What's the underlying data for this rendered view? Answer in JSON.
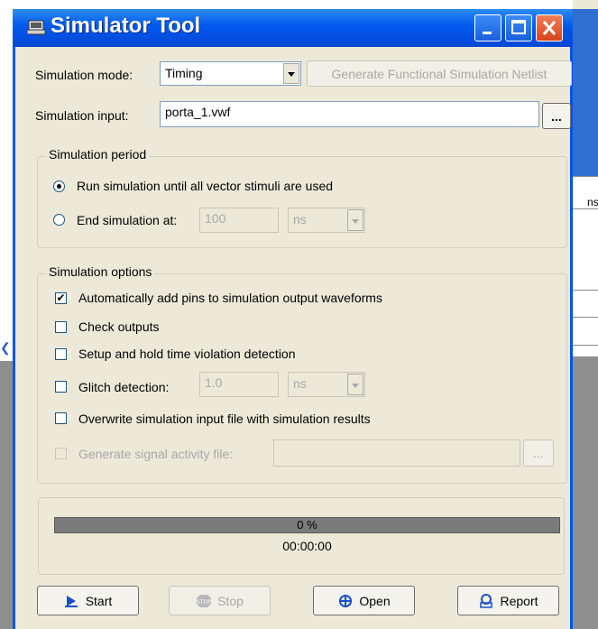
{
  "window": {
    "title": "Simulator Tool"
  },
  "mode": {
    "label": "Simulation mode:",
    "value": "Timing",
    "netlist_button": "Generate Functional Simulation Netlist"
  },
  "input": {
    "label": "Simulation input:",
    "value": "porta_1.vwf",
    "browse": "..."
  },
  "period": {
    "title": "Simulation period",
    "run_all": "Run simulation until all vector stimuli are used",
    "end_at": "End simulation at:",
    "end_value": "100",
    "end_unit": "ns"
  },
  "options": {
    "title": "Simulation options",
    "auto_pins": "Automatically add pins to simulation output waveforms",
    "check_outputs": "Check outputs",
    "setup_hold": "Setup and hold time violation detection",
    "glitch": "Glitch detection:",
    "glitch_value": "1.0",
    "glitch_unit": "ns",
    "overwrite": "Overwrite simulation input file with simulation results",
    "signal_activity": "Generate signal activity file:",
    "signal_browse": "..."
  },
  "progress": {
    "percent_text": "0 %",
    "value": 0,
    "time": "00:00:00"
  },
  "buttons": {
    "start": "Start",
    "stop": "Stop",
    "open": "Open",
    "report": "Report"
  },
  "background": {
    "partial_text": "ns"
  },
  "colors": {
    "titlebar": "#0058ee",
    "dialog": "#ece9d8",
    "progress": "#7b7b7b"
  }
}
